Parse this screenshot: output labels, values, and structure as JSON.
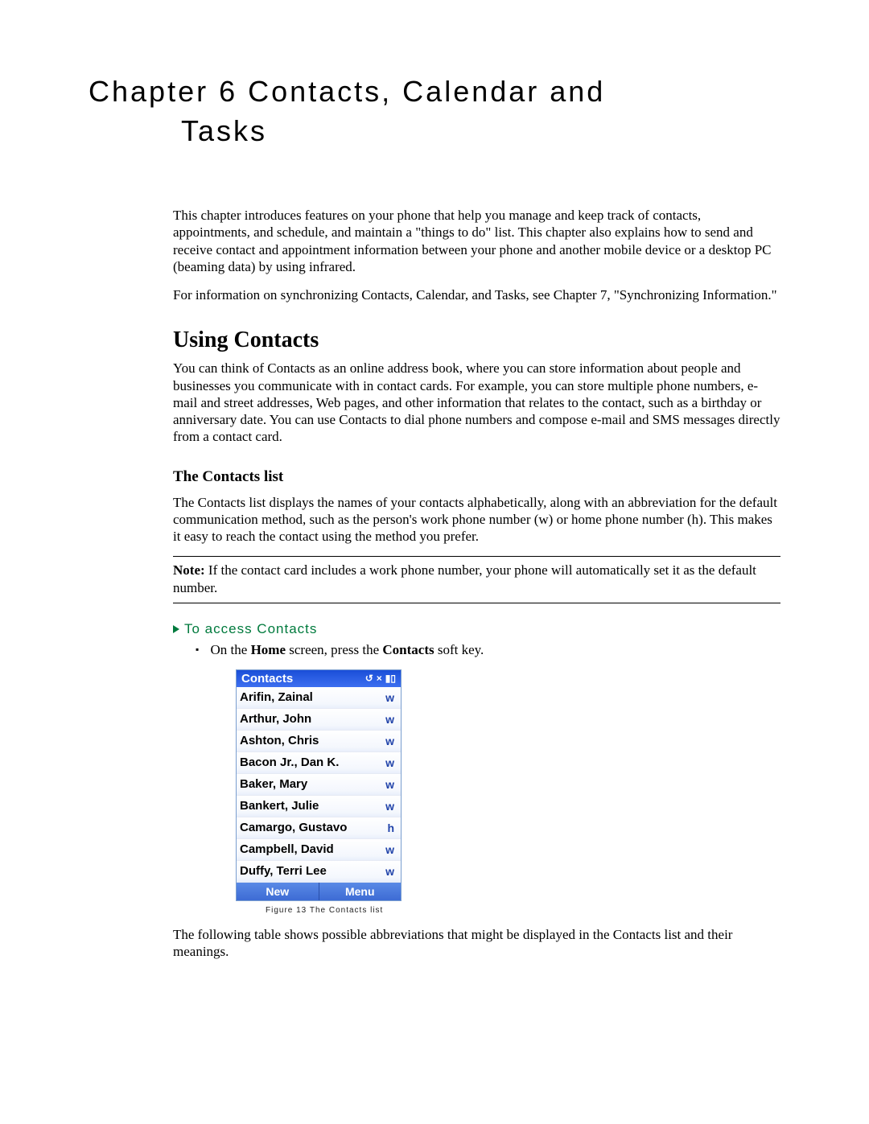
{
  "chapter": {
    "line1": "Chapter 6  Contacts, Calendar and",
    "line2": "Tasks"
  },
  "intro1": "This chapter introduces features on your phone that help you manage and keep track of contacts, appointments, and schedule, and maintain a \"things to do\" list. This chapter also explains how to send and receive contact and appointment information between your phone and another mobile device or a desktop PC (beaming data) by using infrared.",
  "intro2": "For information on synchronizing Contacts, Calendar, and Tasks, see Chapter 7, \"Synchronizing Information.\"",
  "section1": "Using Contacts",
  "section1_body": "You can think of Contacts as an online address book, where you can store information about people and businesses you communicate with in contact cards. For example, you can store multiple phone numbers, e-mail and street addresses, Web pages, and other information that relates to the contact, such as a birthday or anniversary date. You can use Contacts to dial phone numbers and compose e-mail and SMS messages directly from a contact card.",
  "subsection1": "The Contacts list",
  "subsection1_body": "The Contacts list displays the names of your contacts alphabetically, along with an abbreviation for the default communication method, such as the person's work phone number (w) or home phone number (h). This makes it easy to reach the contact using the method you prefer.",
  "note_label": "Note:",
  "note_body": " If the contact card includes a work phone number, your phone will automatically set it as the default number.",
  "proc_heading": "To access Contacts",
  "proc_step_pre": "On the ",
  "proc_step_b1": "Home",
  "proc_step_mid": " screen, press the ",
  "proc_step_b2": "Contacts",
  "proc_step_post": " soft key.",
  "phone": {
    "title": "Contacts",
    "rows": [
      {
        "name": "Arifin, Zainal",
        "abbr": "w"
      },
      {
        "name": "Arthur, John",
        "abbr": "w"
      },
      {
        "name": "Ashton, Chris",
        "abbr": "w"
      },
      {
        "name": "Bacon Jr., Dan K.",
        "abbr": "w"
      },
      {
        "name": "Baker, Mary",
        "abbr": "w"
      },
      {
        "name": "Bankert, Julie",
        "abbr": "w"
      },
      {
        "name": "Camargo, Gustavo",
        "abbr": "h"
      },
      {
        "name": "Campbell, David",
        "abbr": "w"
      },
      {
        "name": "Duffy, Terri Lee",
        "abbr": "w"
      }
    ],
    "softkey_left": "New",
    "softkey_right": "Menu"
  },
  "figcap": "Figure 13 The Contacts list",
  "after_fig": "The following table shows possible abbreviations that might be displayed in the Contacts list and their meanings."
}
